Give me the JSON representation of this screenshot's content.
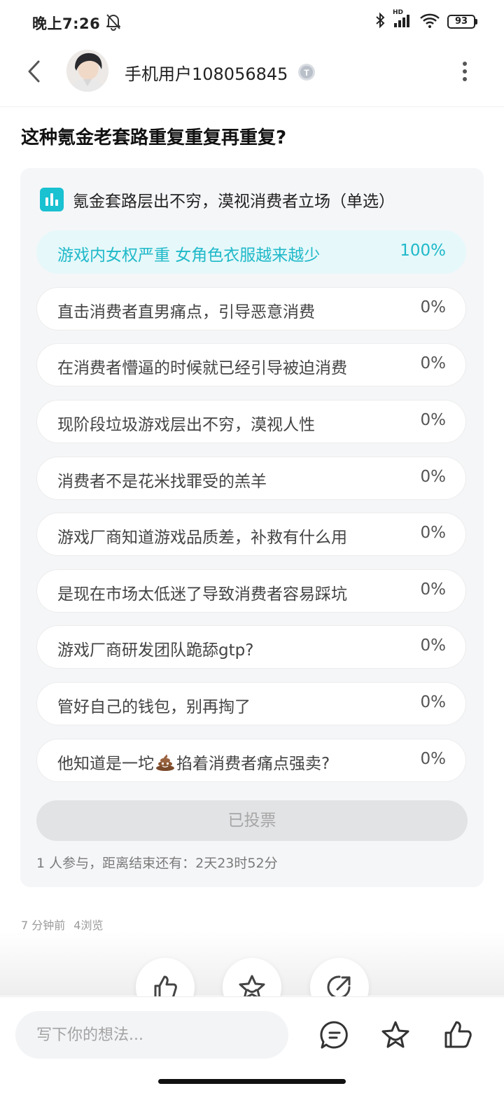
{
  "status_bar": {
    "time": "晚上7:26",
    "battery": "93",
    "net_label": "HD"
  },
  "header": {
    "username": "手机用户108056845",
    "badge_letter": "T"
  },
  "post": {
    "title": "这种氪金老套路重复重复再重复?"
  },
  "poll": {
    "question": "氪金套路层出不穷，漠视消费者立场（单选）",
    "options": [
      {
        "label": "游戏内女权严重 女角色衣服越来越少",
        "percent": "100%",
        "selected": true
      },
      {
        "label": "直击消费者直男痛点，引导恶意消费",
        "percent": "0%"
      },
      {
        "label": "在消费者懵逼的时候就已经引导被迫消费",
        "percent": "0%"
      },
      {
        "label": "现阶段垃圾游戏层出不穷，漠视人性",
        "percent": "0%"
      },
      {
        "label": "消费者不是花米找罪受的羔羊",
        "percent": "0%"
      },
      {
        "label": "游戏厂商知道游戏品质差，补救有什么用",
        "percent": "0%"
      },
      {
        "label": "是现在市场太低迷了导致消费者容易踩坑",
        "percent": "0%"
      },
      {
        "label": "游戏厂商研发团队跪舔gtp?",
        "percent": "0%"
      },
      {
        "label": "管好自己的钱包，别再掏了",
        "percent": "0%"
      },
      {
        "label_before": "他知道是一坨",
        "emoji": "poop-emoji",
        "label_after": "掐着消费者痛点强卖?",
        "percent": "0%"
      }
    ],
    "voted_button": "已投票",
    "footer": "1 人参与，距离结束还有：2天23时52分"
  },
  "meta": {
    "time_ago": "7 分钟前",
    "views": "4浏览"
  },
  "comment_bar": {
    "placeholder": "写下你的想法..."
  },
  "colors": {
    "accent": "#1fb9c9",
    "poll_bg": "#f5f6f8",
    "selected_bg": "#e6f8fa"
  }
}
